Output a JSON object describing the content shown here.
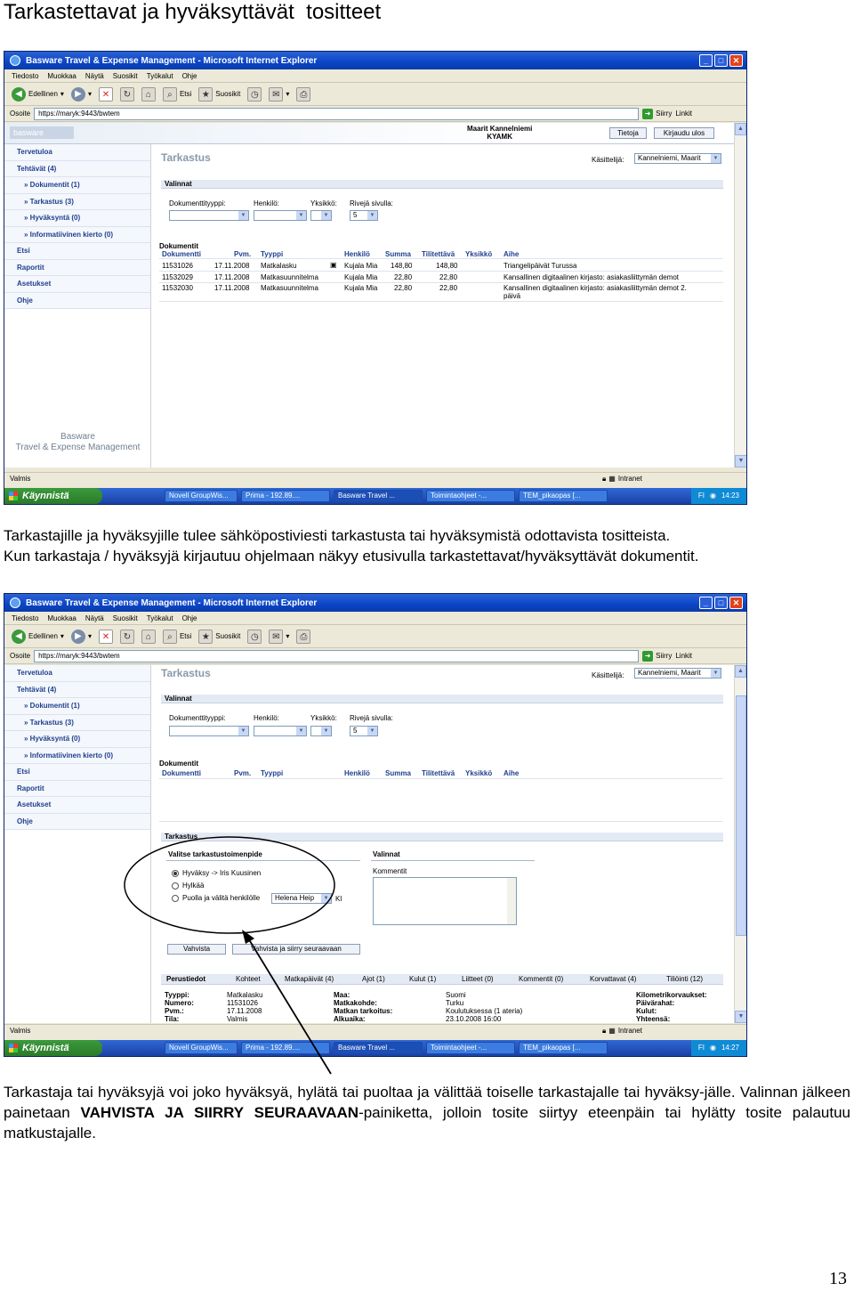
{
  "doc": {
    "title": "Tarkastettavat ja hyväksyttävät  tositteet",
    "para1_line1": "Tarkastajille ja hyväksyjille tulee sähköpostiviesti tarkastusta tai hyväksymistä odottavista tositteista.",
    "para1_line2": "Kun tarkastaja / hyväksyjä kirjautuu ohjelmaan näkyy etusivulla tarkastettavat/hyväksyttävät dokumentit.",
    "para2_a": "Tarkastaja tai hyväksyjä voi joko hyväksyä, hylätä tai puoltaa ja välittää toiselle tarkastajalle tai hyväksy-jälle. Valinnan jälkeen painetaan ",
    "para2_b": "VAHVISTA JA SIIRRY SEURAAVAAN",
    "para2_c": "-painiketta, jolloin tosite siirtyy eteenpäin tai hylätty tosite palautuu matkustajalle.",
    "page_number": "13"
  },
  "browser": {
    "window_title": "Basware Travel & Expense Management - Microsoft Internet Explorer",
    "menu": [
      "Tiedosto",
      "Muokkaa",
      "Näytä",
      "Suosikit",
      "Työkalut",
      "Ohje"
    ],
    "back_label": "Edellinen",
    "search_label": "Etsi",
    "favorites_label": "Suosikit",
    "address_label": "Osoite",
    "address_value": "https://maryk:9443/bwtem",
    "go_label": "Siirry",
    "links_label": "Linkit",
    "status_ready": "Valmis",
    "zone_label": "Intranet"
  },
  "app": {
    "logo_text": "basware",
    "user_name": "Maarit Kannelniemi",
    "user_org": "KYAMK",
    "info_btn": "Tietoja",
    "logout_btn": "Kirjaudu ulos",
    "sidebar": [
      {
        "label": "Tervetuloa",
        "sub": false
      },
      {
        "label": "Tehtävät (4)",
        "sub": false
      },
      {
        "label": "» Dokumentit (1)",
        "sub": true
      },
      {
        "label": "» Tarkastus (3)",
        "sub": true
      },
      {
        "label": "» Hyväksyntä (0)",
        "sub": true
      },
      {
        "label": "» Informatiivinen kierto (0)",
        "sub": true
      },
      {
        "label": "Etsi",
        "sub": false
      },
      {
        "label": "Raportit",
        "sub": false
      },
      {
        "label": "Asetukset",
        "sub": false
      },
      {
        "label": "Ohje",
        "sub": false
      }
    ],
    "sidebar_footer_1": "Basware",
    "sidebar_footer_2": "Travel & Expense Management",
    "main_title": "Tarkastus",
    "handler_label": "Käsittelijä:",
    "handler_value": "Kannelniemi, Maarit",
    "filters_head": "Valinnat",
    "filter_doctype": "Dokumenttityyppi:",
    "filter_person": "Henkilö:",
    "filter_unit": "Yksikkö:",
    "filter_rows": "Rivejä sivulla:",
    "rows_value": "5",
    "docs_head": "Dokumentit",
    "columns": [
      "Dokumentti",
      "Pvm.",
      "Tyyppi",
      "Henkilö",
      "Summa",
      "Tilitettävä",
      "Yksikkö",
      "Aihe"
    ],
    "rows": [
      [
        "11531026",
        "17.11.2008",
        "Matkalasku",
        "Kujala Mia",
        "148,80",
        "148,80",
        "",
        "Triangelipäivät Turussa"
      ],
      [
        "11532029",
        "17.11.2008",
        "Matkasuunnitelma",
        "Kujala Mia",
        "22,80",
        "22,80",
        "",
        "Kansallinen digitaalinen kirjasto: asiakasliittymän demot"
      ],
      [
        "11532030",
        "17.11.2008",
        "Matkasuunnitelma",
        "Kujala Mia",
        "22,80",
        "22,80",
        "",
        "Kansallinen digitaalinen kirjasto: asiakasliittymän demot 2."
      ]
    ],
    "row3_extra": "päivä"
  },
  "review": {
    "section_head": "Tarkastus",
    "choose_head": "Valitse tarkastustoimenpide",
    "options_head": "Valinnat",
    "opt_approve": "Hyväksy -> Iris Kuusinen",
    "opt_reject": "Hylkää",
    "opt_forward": "Puolla ja välitä henkilölle",
    "forward_person": "Helena Heip",
    "forward_suffix": "Kl",
    "comments_label": "Kommentit",
    "confirm_btn": "Vahvista",
    "confirm_next_btn": "Vahvista ja siirry seuraavaan",
    "tabs": [
      "Perustiedot",
      "Kohteet",
      "Matkapäivät (4)",
      "Ajot (1)",
      "Kulut (1)",
      "Liitteet (0)",
      "Kommentit (0)",
      "Korvattavat (4)",
      "Tiliöinti (12)"
    ],
    "basic_col1_labels": [
      "Tyyppi:",
      "Numero:",
      "Pvm.:",
      "Tila:"
    ],
    "basic_col1_values": [
      "Matkalasku",
      "11531026",
      "17.11.2008",
      "Valmis"
    ],
    "basic_col2_labels": [
      "Maa:",
      "Matkakohde:",
      "Matkan tarkoitus:",
      "Alkuaika:"
    ],
    "basic_col2_values": [
      "Suomi",
      "Turku",
      "Koulutuksessa (1 ateria)",
      "23.10.2008 16:00"
    ],
    "basic_col3_labels": [
      "Kilometrikorvaukset:",
      "Päivärahat:",
      "Kulut:",
      "Yhteensä:"
    ]
  },
  "taskbar": {
    "start": "Käynnistä",
    "tasks": [
      "Novell GroupWis...",
      "Prima - 192.89....",
      "Basware Travel ...",
      "Toimintaohjeet -...",
      "TEM_pikaopas [..."
    ],
    "lang": "FI",
    "time1": "14:23",
    "time2": "14:27"
  },
  "colors": {
    "accent": "#0b45c7",
    "link": "#1f3f8f",
    "annotation": "#000000"
  }
}
